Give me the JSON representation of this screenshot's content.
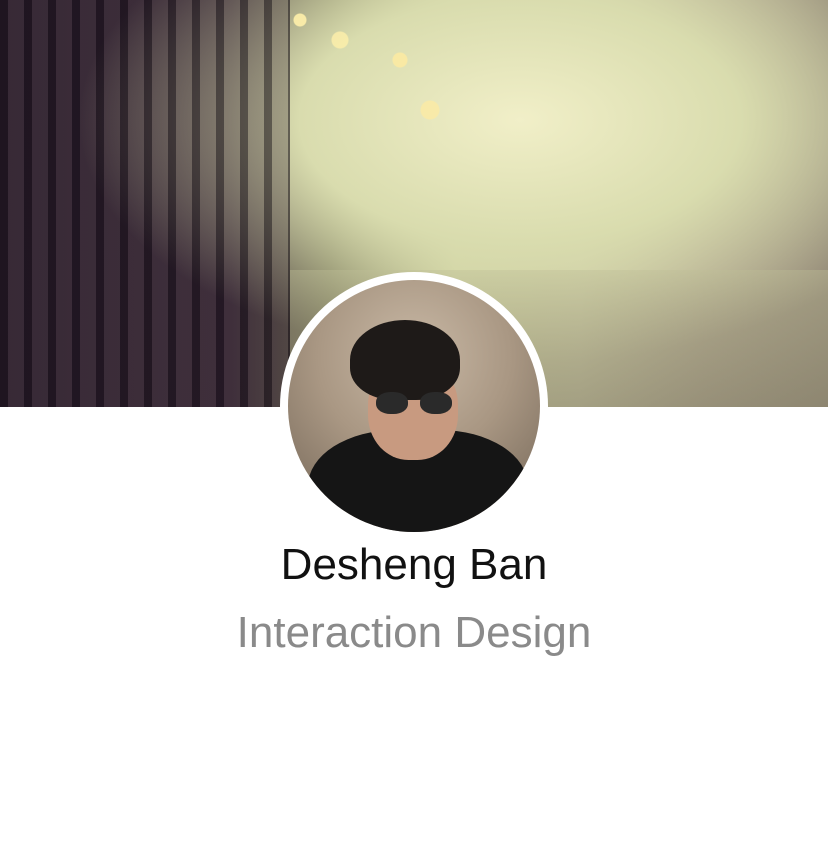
{
  "profile": {
    "name": "Desheng Ban",
    "role": "Interaction Design"
  }
}
